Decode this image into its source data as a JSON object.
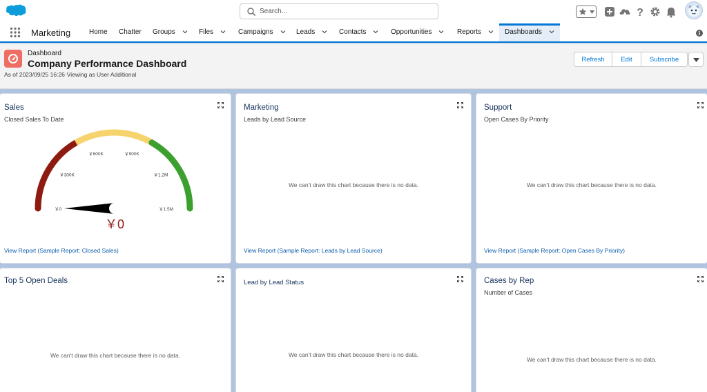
{
  "header": {
    "search_placeholder": "Search...",
    "icons": [
      "salesforce-cloud-logo",
      "favorites-star-icon",
      "add-icon",
      "trailhead-icon",
      "help-icon",
      "setup-gear-icon",
      "notification-bell-icon",
      "user-avatar"
    ]
  },
  "nav": {
    "app_name": "Marketing",
    "items": [
      {
        "label": "Home",
        "has_menu": false
      },
      {
        "label": "Chatter",
        "has_menu": false
      },
      {
        "label": "Groups",
        "has_menu": true
      },
      {
        "label": "Files",
        "has_menu": true
      },
      {
        "label": "Campaigns",
        "has_menu": true
      },
      {
        "label": "Leads",
        "has_menu": true
      },
      {
        "label": "Contacts",
        "has_menu": true
      },
      {
        "label": "Opportunities",
        "has_menu": true
      },
      {
        "label": "Reports",
        "has_menu": true
      },
      {
        "label": "Dashboards",
        "has_menu": true,
        "active": true
      }
    ]
  },
  "page": {
    "object_label": "Dashboard",
    "title": "Company Performance Dashboard",
    "subtitle": "As of 2023/09/25 16:26·Viewing as User Additional",
    "buttons": {
      "refresh": "Refresh",
      "edit": "Edit",
      "subscribe": "Subscribe"
    }
  },
  "cards": {
    "sales": {
      "title": "Sales",
      "subtitle": "Closed Sales To Date",
      "view_report": "View Report (Sample Report: Closed Sales)"
    },
    "marketing": {
      "title": "Marketing",
      "subtitle": "Leads by Lead Source",
      "no_data": "We can't draw this chart because there is no data.",
      "view_report": "View Report (Sample Report: Leads by Lead Source)"
    },
    "support": {
      "title": "Support",
      "subtitle": "Open Cases By Priority",
      "no_data": "We can't draw this chart because there is no data.",
      "view_report": "View Report (Sample Report: Open Cases By Priority)"
    },
    "top_deals": {
      "title": "Top 5 Open Deals",
      "no_data": "We can't draw this chart because there is no data."
    },
    "lead_status": {
      "title": "Lead by Lead Status",
      "no_data": "We can't draw this chart because there is no data."
    },
    "cases_by_rep": {
      "title": "Cases by Rep",
      "subtitle": "Number of Cases",
      "no_data": "We can't draw this chart because there is no data."
    }
  },
  "chart_data": {
    "type": "gauge",
    "value": 0,
    "value_label": "￥0",
    "min": 0,
    "max": 1500000,
    "ticks": [
      {
        "value": 0,
        "label": "￥0"
      },
      {
        "value": 300000,
        "label": "￥300K"
      },
      {
        "value": 600000,
        "label": "￥600K"
      },
      {
        "value": 900000,
        "label": "￥900K"
      },
      {
        "value": 1200000,
        "label": "￥1.2M"
      },
      {
        "value": 1500000,
        "label": "￥1.5M"
      }
    ],
    "bands": [
      {
        "from": 0,
        "to": 500000,
        "color": "#8e1b10"
      },
      {
        "from": 500000,
        "to": 1000000,
        "color": "#f6d36c"
      },
      {
        "from": 1000000,
        "to": 1500000,
        "color": "#3ba02e"
      }
    ]
  },
  "colors": {
    "brand": "#0176d3",
    "link": "#0b5cab",
    "dashboard_icon": "#ef6e64",
    "page_background": "#b0c4df"
  }
}
